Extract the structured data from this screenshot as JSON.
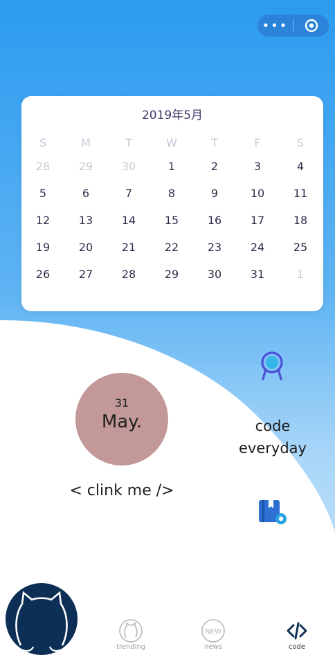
{
  "nav_capsule": {
    "more_icon": "more-dots-icon",
    "close_icon": "target-circle-icon"
  },
  "calendar": {
    "title": "2019年5月",
    "weekdays": [
      "S",
      "M",
      "T",
      "W",
      "T",
      "F",
      "S"
    ],
    "weeks": [
      [
        "28",
        "29",
        "30",
        "1",
        "2",
        "3",
        "4"
      ],
      [
        "5",
        "6",
        "7",
        "8",
        "9",
        "10",
        "11"
      ],
      [
        "12",
        "13",
        "14",
        "15",
        "16",
        "17",
        "18"
      ],
      [
        "19",
        "20",
        "21",
        "22",
        "23",
        "24",
        "25"
      ],
      [
        "26",
        "27",
        "28",
        "29",
        "30",
        "31",
        "1"
      ]
    ],
    "muted_days": {
      "0": [
        0,
        1,
        2
      ],
      "4": [
        6
      ]
    }
  },
  "today": {
    "day": "31",
    "month": "May."
  },
  "clink_text": "< clink me />",
  "code_everyday": {
    "line1": "code",
    "line2": "everyday"
  },
  "tabs": [
    {
      "label": "trending",
      "icon": "github-cat-icon"
    },
    {
      "label": "news",
      "icon": "new-badge-icon"
    },
    {
      "label": "code",
      "icon": "code-brackets-icon"
    }
  ],
  "colors": {
    "accent": "#2b9bf0",
    "date_circle": "#c29898",
    "avatar": "#0d2f55",
    "award_icon": "#4b4fd8"
  }
}
